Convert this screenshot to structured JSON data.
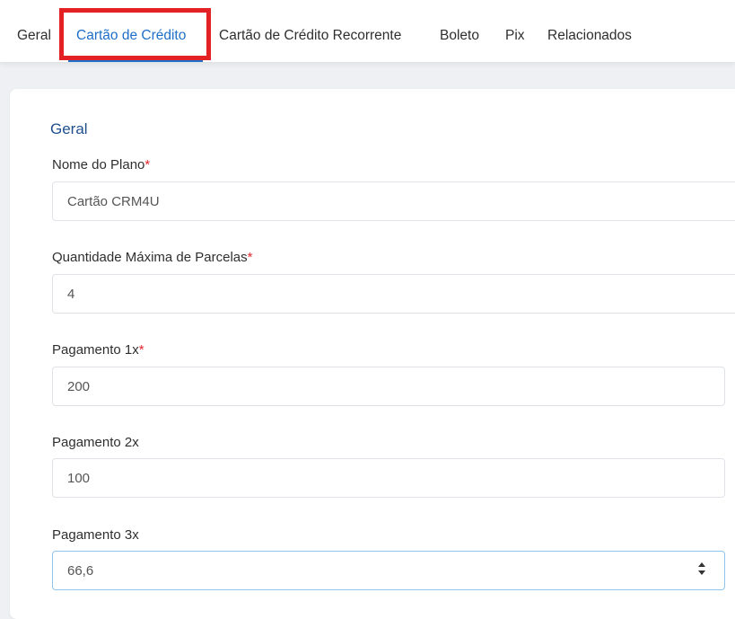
{
  "tabs": {
    "geral": "Geral",
    "cartao_credito": "Cartão de Crédito",
    "cartao_recorrente": "Cartão de Crédito Recorrente",
    "boleto": "Boleto",
    "pix": "Pix",
    "relacionados": "Relacionados",
    "active": "Cartão de Crédito"
  },
  "form": {
    "section_title": "Geral",
    "required_marker": "*",
    "fields": [
      {
        "label": "Nome do Plano",
        "required": true,
        "value": "Cartão CRM4U"
      },
      {
        "label": "Quantidade Máxima de Parcelas",
        "required": true,
        "value": "4"
      },
      {
        "label": "Pagamento 1x",
        "required": true,
        "value": "200"
      },
      {
        "label": "Pagamento 2x",
        "required": false,
        "value": "100"
      },
      {
        "label": "Pagamento 3x",
        "required": false,
        "value": "66,6"
      }
    ]
  },
  "colors": {
    "accent": "#1e6fc9",
    "highlight": "#e32024",
    "required": "#e3262d",
    "section_title": "#1f4f8f"
  },
  "icons": {
    "spinner": "number-spinner-icon"
  }
}
